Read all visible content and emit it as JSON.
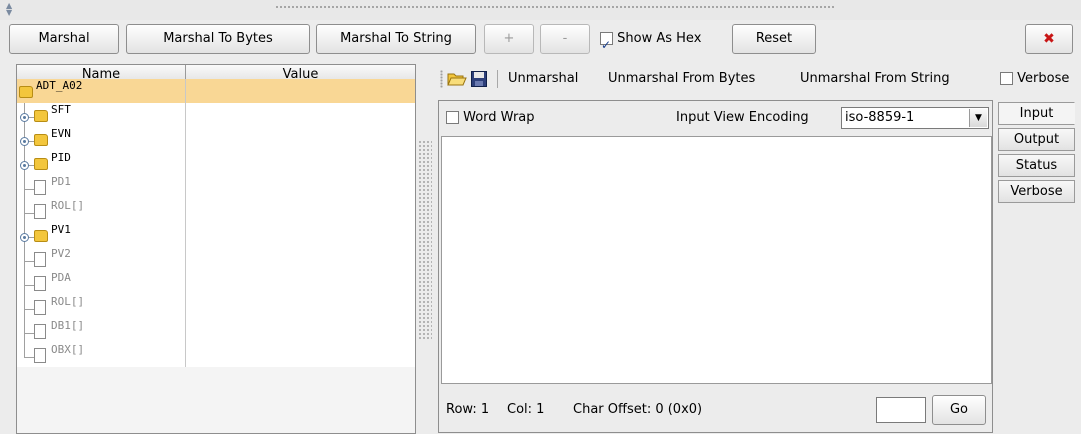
{
  "toolbar": {
    "marshal_label": "Marshal",
    "marshal_to_bytes_label": "Marshal To Bytes",
    "marshal_to_string_label": "Marshal To String",
    "plus_label": "+",
    "minus_label": "-",
    "show_as_hex_label": "Show As Hex",
    "show_as_hex_checked": true,
    "reset_label": "Reset",
    "close_icon": "close-icon"
  },
  "tree": {
    "columns": [
      "Name",
      "Value"
    ],
    "rows": [
      {
        "name": "ADT_A02",
        "type": "folder",
        "depth": 0,
        "selected": true
      },
      {
        "name": "SFT",
        "type": "folder",
        "depth": 1,
        "expandable": true
      },
      {
        "name": "EVN",
        "type": "folder",
        "depth": 1,
        "expandable": true
      },
      {
        "name": "PID",
        "type": "folder",
        "depth": 1,
        "expandable": true
      },
      {
        "name": "PD1",
        "type": "leaf",
        "depth": 1
      },
      {
        "name": "ROL[]",
        "type": "leaf",
        "depth": 1
      },
      {
        "name": "PV1",
        "type": "folder",
        "depth": 1,
        "expandable": true
      },
      {
        "name": "PV2",
        "type": "leaf",
        "depth": 1
      },
      {
        "name": "PDA",
        "type": "leaf",
        "depth": 1
      },
      {
        "name": "ROL[]",
        "type": "leaf",
        "depth": 1
      },
      {
        "name": "DB1[]",
        "type": "leaf",
        "depth": 1
      },
      {
        "name": "OBX[]",
        "type": "leaf",
        "depth": 1
      }
    ]
  },
  "right_toolbar": {
    "open_icon": "open-folder-icon",
    "save_icon": "save-icon",
    "unmarshal_label": "Unmarshal",
    "unmarshal_from_bytes_label": "Unmarshal From Bytes",
    "unmarshal_from_string_label": "Unmarshal From String",
    "verbose_label": "Verbose"
  },
  "input_panel": {
    "word_wrap_label": "Word Wrap",
    "encoding_label": "Input View Encoding",
    "encoding_value": "iso-8859-1",
    "text_value": "",
    "status_row": "Row: 1",
    "status_col": "Col: 1",
    "status_offset": "Char Offset: 0 (0x0)",
    "go_label": "Go",
    "go_input_value": ""
  },
  "side_tabs": [
    "Input",
    "Output",
    "Status",
    "Verbose"
  ],
  "colors": {
    "selected_row": "#f9d795",
    "folder": "#f3c63c",
    "close": "#c81616"
  }
}
